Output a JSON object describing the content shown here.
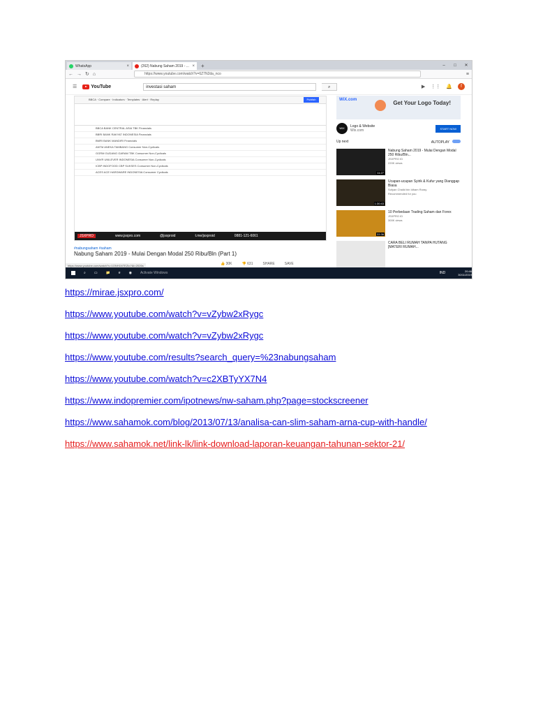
{
  "screenshot": {
    "tabs": [
      {
        "label": "WhatsApp"
      },
      {
        "label": "(262) Nabung Saham 2019 - ..."
      }
    ],
    "address_bar": "https://www.youtube.com/watch?v=6Z7N2da_nco",
    "youtube_logo": "YouTube",
    "search_query": "investasi saham",
    "player_brand": "JSXPRO",
    "player_site": "www.jsxpro.com",
    "player_handle": "@jsxproid",
    "player_telegram": "t.me/jsxproid",
    "player_phone": "0881-121-6061",
    "hashtags": "#nabungsaham #saham",
    "video_title": "Nabung Saham 2019 - Mulai Dengan Modal 250 Ribu/Bln (Part 1)",
    "status_url": "https://www.youtube.com/watch?v=1ONH1NTEZio?&t=2026s",
    "actions": {
      "likes": "30K",
      "dislikes": "631",
      "share": "SHARE",
      "save": "SAVE"
    },
    "publish_label": "Publish",
    "stock_rows": [
      "BBCA  BANK CENTRAL ASIA TBK  Financials",
      "BBRI  BANK RAKYAT INDONESIA  Financials",
      "BMRI  BANK MANDIRI  Financials",
      "ANTM  ANEKA TAMBANG  Consumer Non-Cyclicals",
      "GGRM  GUDANG GARAM TBK  Consumer Non-Cyclicals",
      "UNVR  UNILEVER INDONESIA  Consumer Non-Cyclicals",
      "ICBP  INDOFOOD CBP SUKSES  Consumer Non-Cyclicals",
      "ACES  ACE HARDWARE INDONESIA  Consumer Cyclicals"
    ],
    "ad": {
      "brand": "WiX.com",
      "headline": "Get Your Logo Today!",
      "title": "Logo & Website",
      "domain": "Wix.com",
      "cta": "START NOW"
    },
    "up_next": "Up next",
    "autoplay": "AUTOPLAY",
    "videos": [
      {
        "title": "Nabung Saham 2019 - Mulai Dengan Modal 250 Ribu/Bln...",
        "channel": "JSXPRO ID",
        "views": "220K views",
        "duration": "11:27",
        "color": "#1d1d1d"
      },
      {
        "title": "Ucapan-ucapan Syirik & Kufur yang Dianggap Biasa",
        "channel": "Sofyan Chalid bin Idham Ruray",
        "views": "Recommended for you",
        "duration": "1:30:43",
        "color": "#2b2418"
      },
      {
        "title": "10 Perbedaan Trading Saham dan Forex",
        "channel": "JSXPRO ID",
        "views": "300K views",
        "duration": "22:36",
        "color": "#c98a1a"
      },
      {
        "title": "CARA BELI RUMAH TANPA HUTANG [MATERI RUMAH...",
        "channel": "",
        "views": "",
        "duration": "",
        "color": "#e8e8e8"
      }
    ],
    "windows_watermark": "Activate Windows",
    "clock": {
      "time": "20:46",
      "date": "30/11/2019",
      "lang": "IND"
    }
  },
  "links": [
    {
      "text": "https://mirae.jsxpro.com/",
      "color": "#0b0bd8"
    },
    {
      "text": "https://www.youtube.com/watch?v=vZybw2xRygc",
      "color": "#0b0bd8"
    },
    {
      "text": "https://www.youtube.com/watch?v=vZybw2xRygc",
      "color": "#0b0bd8"
    },
    {
      "text": "https://www.youtube.com/results?search_query=%23nabungsaham",
      "color": "#0b0bd8"
    },
    {
      "text": "https://www.youtube.com/watch?v=c2XBTyYX7N4",
      "color": "#0b0bd8"
    },
    {
      "text": "https://www.indopremier.com/ipotnews/nw-saham.php?page=stockscreener",
      "color": "#0b0bd8"
    },
    {
      "text": "https://www.sahamok.com/blog/2013/07/13/analisa-can-slim-saham-arna-cup-with-handle/",
      "color": "#0b0bd8"
    },
    {
      "text": "https://www.sahamok.net/link-lk/link-download-laporan-keuangan-tahunan-sektor-21/",
      "color": "#e51c1c"
    }
  ]
}
